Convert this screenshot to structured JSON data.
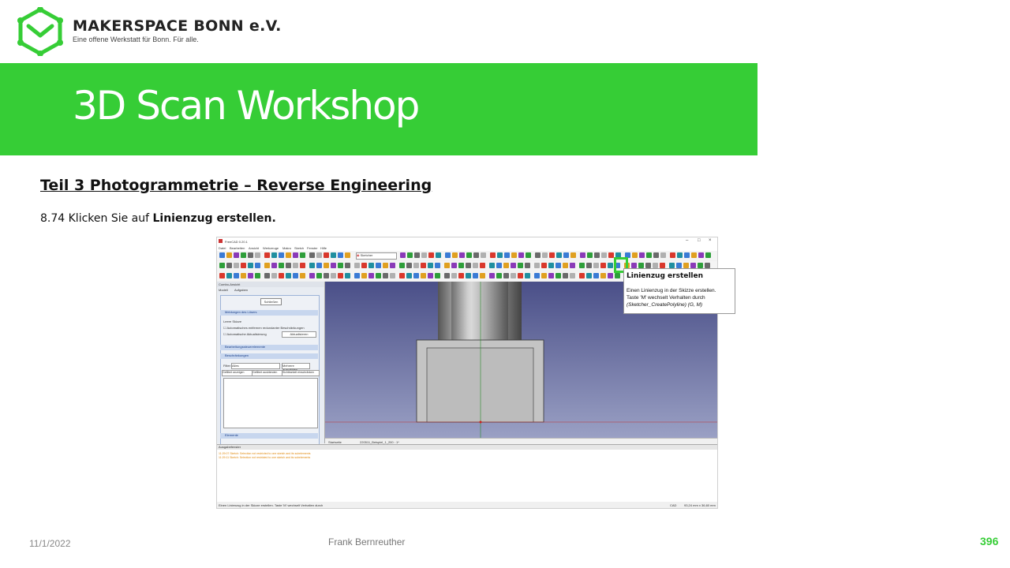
{
  "brand": {
    "name": "MAKERSPACE BONN e.V.",
    "tagline": "Eine offene Werkstatt für Bonn. Für alle."
  },
  "banner": {
    "title": "3D Scan Workshop"
  },
  "subtitle": "Teil 3  Photogrammetrie  – Reverse Engineering",
  "step": {
    "prefix": "8.74 Klicken Sie auf ",
    "bold": "Linienzug erstellen."
  },
  "footer": {
    "date": "11/1/2022",
    "author": "Frank Bernreuther",
    "page": "396"
  },
  "colors": {
    "accent": "#36cd36"
  },
  "screenshot": {
    "window_title": "FreeCAD 0.20.1",
    "menu": [
      "Datei",
      "Bearbeiten",
      "Ansicht",
      "Werkzeuge",
      "Makro",
      "Sketch",
      "Fenster",
      "Hilfe"
    ],
    "workbench": "Sketcher",
    "panel": {
      "title": "Combo-Ansicht",
      "tabs": [
        "Modell",
        "Aufgaben"
      ],
      "close_button": "Schließen",
      "sections": {
        "solver": "Meldungen des Lösers",
        "solver_msg": "Leere Skizze",
        "auto_remove": "Automatisches entfernen redundanter Beschränkungen",
        "auto_update": "Automatische Aktualisierung",
        "update_button": "Aktualisieren",
        "edit_controls": "Bearbeitungssteuerelemente",
        "constraints": "Beschränkungen",
        "filter_label": "Filter:",
        "filter_value": "Alles",
        "filter_multiple": "Mehrere auswählen",
        "btn_show": "Gefiltert anzeigen",
        "btn_hide": "Gefiltert ausblenden",
        "btn_visibility": "Sichtbarkeit einschränken",
        "elements": "Elemente"
      }
    },
    "view_tabs": [
      "Startseite",
      "220511_Beispiel_1_200 : 1*"
    ],
    "output": {
      "title": "Ausgabefenster",
      "lines": [
        "11:29:07 Sketch: Selection not restricted to one sketch and its subelements",
        "11:29:11 Sketch: Selection not restricted to one sketch and its subelements"
      ]
    },
    "status_left": "Einen Linienzug in der Skizze erstellen. Taste 'M' wechselt Verhalten durch",
    "status_right": "CAD",
    "status_dim": "93,24 mm x 36,60 mm",
    "tooltip": {
      "title": "Linienzug erstellen",
      "line1": "Einen Linienzug in der Skizze erstellen.",
      "line2": "Taste 'M' wechselt Verhalten durch",
      "line3": "(Sketcher_CreatePolyline) (G, M)"
    }
  }
}
